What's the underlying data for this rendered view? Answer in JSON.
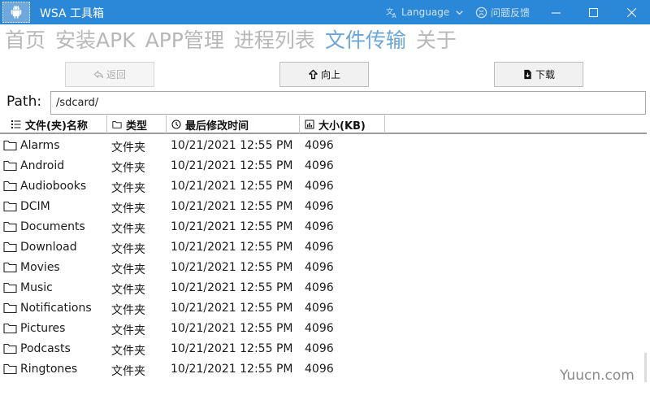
{
  "window": {
    "title": "WSA 工具箱",
    "language_label": "Language",
    "feedback_label": "问题反馈"
  },
  "nav": {
    "tabs": [
      {
        "label": "首页",
        "active": false
      },
      {
        "label": "安装APK",
        "active": false
      },
      {
        "label": "APP管理",
        "active": false
      },
      {
        "label": "进程列表",
        "active": false
      },
      {
        "label": "文件传输",
        "active": true
      },
      {
        "label": "关于",
        "active": false
      }
    ]
  },
  "toolbar": {
    "back_label": "返回",
    "up_label": "向上",
    "download_label": "下载"
  },
  "path": {
    "label": "Path:",
    "value": "/sdcard/"
  },
  "table": {
    "headers": {
      "name": "文件(夹)名称",
      "type": "类型",
      "modified": "最后修改时间",
      "size": "大小(KB)"
    },
    "rows": [
      {
        "name": "Alarms",
        "type": "文件夹",
        "modified": "10/21/2021 12:55 PM",
        "size": "4096"
      },
      {
        "name": "Android",
        "type": "文件夹",
        "modified": "10/21/2021 12:55 PM",
        "size": "4096"
      },
      {
        "name": "Audiobooks",
        "type": "文件夹",
        "modified": "10/21/2021 12:55 PM",
        "size": "4096"
      },
      {
        "name": "DCIM",
        "type": "文件夹",
        "modified": "10/21/2021 12:55 PM",
        "size": "4096"
      },
      {
        "name": "Documents",
        "type": "文件夹",
        "modified": "10/21/2021 12:55 PM",
        "size": "4096"
      },
      {
        "name": "Download",
        "type": "文件夹",
        "modified": "10/21/2021 12:55 PM",
        "size": "4096"
      },
      {
        "name": "Movies",
        "type": "文件夹",
        "modified": "10/21/2021 12:55 PM",
        "size": "4096"
      },
      {
        "name": "Music",
        "type": "文件夹",
        "modified": "10/21/2021 12:55 PM",
        "size": "4096"
      },
      {
        "name": "Notifications",
        "type": "文件夹",
        "modified": "10/21/2021 12:55 PM",
        "size": "4096"
      },
      {
        "name": "Pictures",
        "type": "文件夹",
        "modified": "10/21/2021 12:55 PM",
        "size": "4096"
      },
      {
        "name": "Podcasts",
        "type": "文件夹",
        "modified": "10/21/2021 12:55 PM",
        "size": "4096"
      },
      {
        "name": "Ringtones",
        "type": "文件夹",
        "modified": "10/21/2021 12:55 PM",
        "size": "4096"
      }
    ]
  },
  "watermark": "Yuucn.com",
  "colors": {
    "titlebar": "#2b88d8",
    "active_tab": "#6aa6d8",
    "inactive_tab": "#b8b8b8"
  }
}
